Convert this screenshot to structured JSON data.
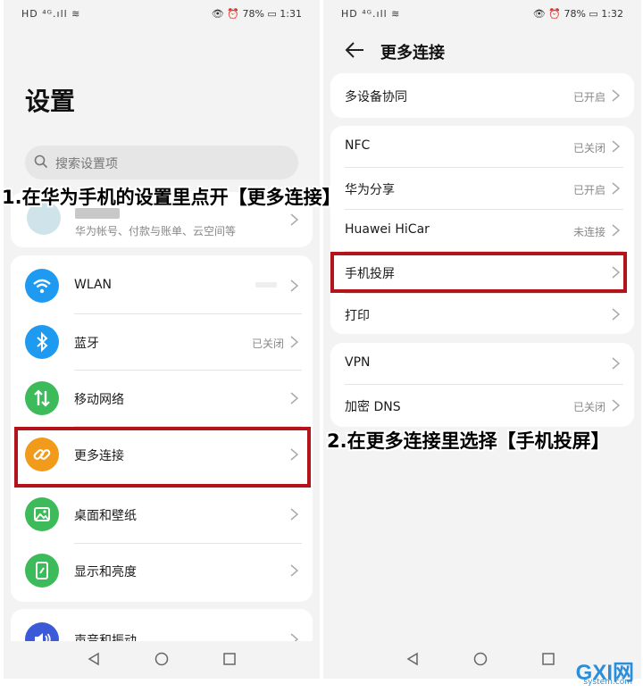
{
  "left": {
    "status": {
      "carrier": "HD ⁴ᴳ.ıll ≋",
      "right": "👁 ⏰ 78% ▭ 1:31"
    },
    "title": "设置",
    "search_placeholder": "搜索设置项",
    "account_sub": "华为帐号、付款与账单、云空间等",
    "items": [
      {
        "label": "WLAN",
        "value": ""
      },
      {
        "label": "蓝牙",
        "value": "已关闭"
      },
      {
        "label": "移动网络",
        "value": ""
      },
      {
        "label": "更多连接",
        "value": ""
      },
      {
        "label": "桌面和壁纸",
        "value": ""
      },
      {
        "label": "显示和亮度",
        "value": ""
      },
      {
        "label": "声音和振动",
        "value": ""
      }
    ]
  },
  "right": {
    "status": {
      "carrier": "HD ⁴ᴳ.ıll ≋",
      "right": "👁 ⏰ 78% ▭ 1:32"
    },
    "title": "更多连接",
    "items": [
      {
        "label": "多设备协同",
        "value": "已开启"
      },
      {
        "label": "NFC",
        "value": "已关闭"
      },
      {
        "label": "华为分享",
        "value": "已开启"
      },
      {
        "label": "Huawei HiCar",
        "value": "未连接"
      },
      {
        "label": "手机投屏",
        "value": ""
      },
      {
        "label": "打印",
        "value": ""
      },
      {
        "label": "VPN",
        "value": ""
      },
      {
        "label": "加密 DNS",
        "value": "已关闭"
      }
    ]
  },
  "captions": {
    "step1": "1.在华为手机的设置里点开【更多连接】",
    "step2": "2.在更多连接里选择【手机投屏】"
  },
  "watermark": {
    "brand": "GXI网",
    "domain": "system.com"
  },
  "colors": {
    "highlight": "#b3141c",
    "wlan": "#1e9bf0",
    "bluetooth": "#1e9bf0",
    "mobile": "#3dbb5a",
    "more": "#f29a1a",
    "desktop": "#3dbb5a",
    "display": "#3dbb5a",
    "sound": "#3c5ad8"
  }
}
